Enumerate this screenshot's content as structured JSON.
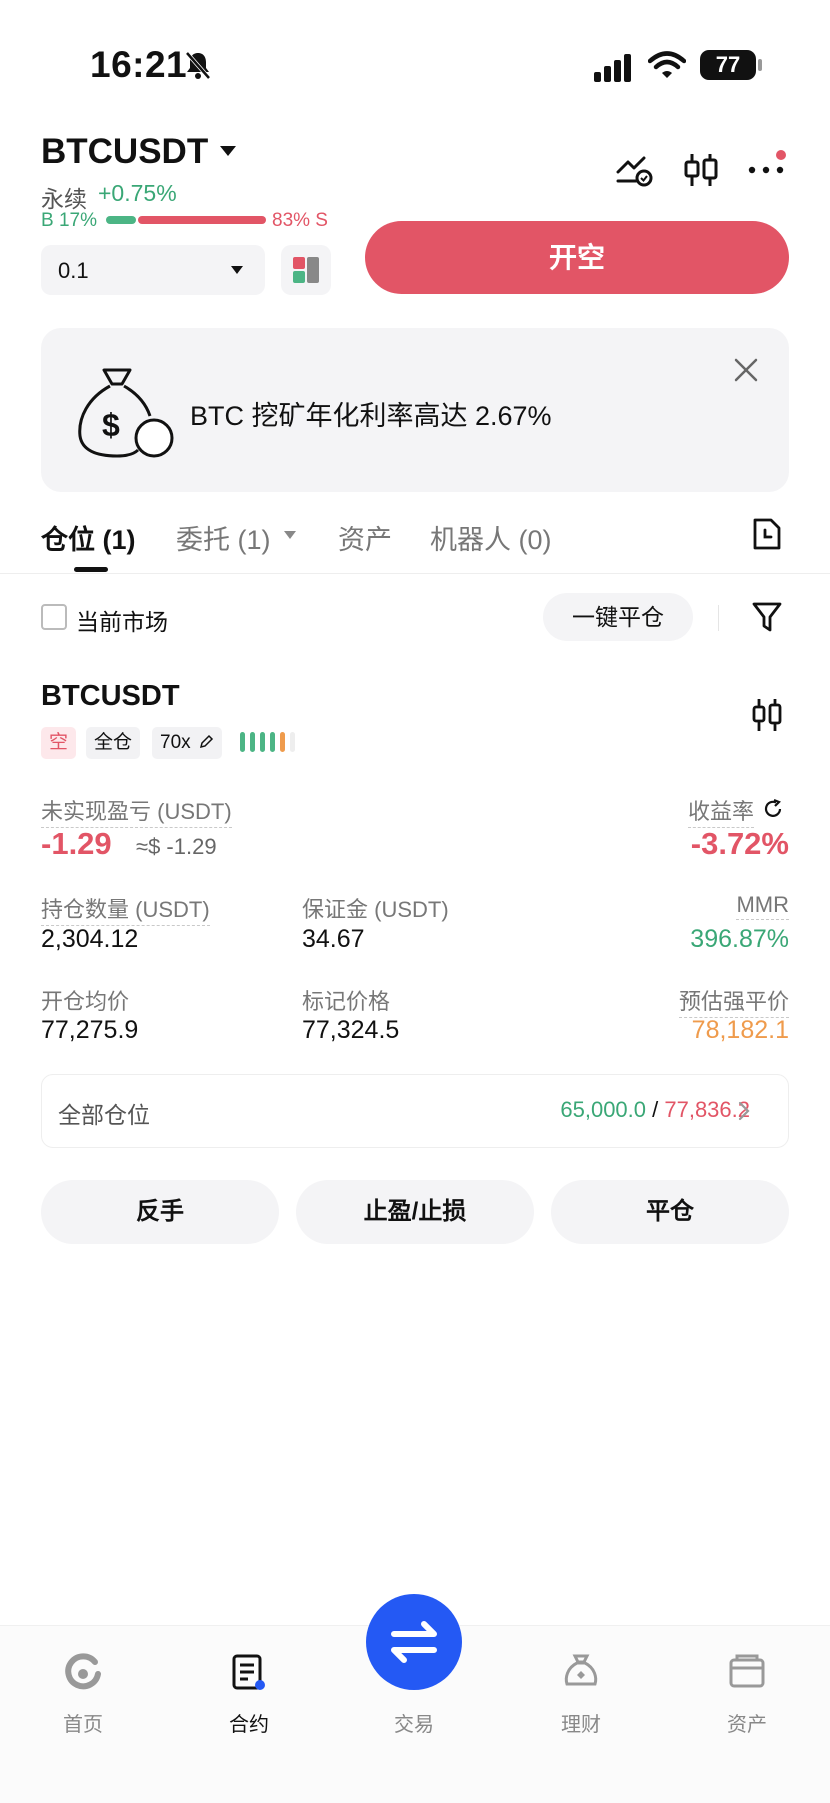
{
  "status_bar": {
    "time": "16:21",
    "battery": "77"
  },
  "header": {
    "pair": "BTCUSDT",
    "perp_label": "永续",
    "change": "+0.75%",
    "buy_ratio": "B 17%",
    "sell_ratio": "83% S",
    "buy_fraction": 0.17,
    "icons": [
      "price-alert-icon",
      "candlestick-icon",
      "more-icon"
    ]
  },
  "order": {
    "quantity": "0.1",
    "open_short_label": "开空"
  },
  "banner": {
    "text": "BTC 挖矿年化利率高达 2.67%"
  },
  "tabs": [
    {
      "label": "仓位 (1)",
      "active": true
    },
    {
      "label": "委托 (1)",
      "active": false
    },
    {
      "label": "资产",
      "active": false
    },
    {
      "label": "机器人 (0)",
      "active": false
    }
  ],
  "filters": {
    "current_market": "当前市场",
    "close_all": "一键平仓"
  },
  "position": {
    "symbol": "BTCUSDT",
    "side_tag": "空",
    "margin_mode": "全仓",
    "leverage": "70x",
    "unrealized_pnl_label": "未实现盈亏 (USDT)",
    "unrealized_pnl": "-1.29",
    "unrealized_pnl_usd": "≈$ -1.29",
    "roe_label": "收益率",
    "roe": "-3.72%",
    "size_label": "持仓数量 (USDT)",
    "size": "2,304.12",
    "margin_label": "保证金 (USDT)",
    "margin": "34.67",
    "mmr_label": "MMR",
    "mmr": "396.87%",
    "entry_label": "开仓均价",
    "entry_price": "77,275.9",
    "mark_label": "标记价格",
    "mark_price": "77,324.5",
    "liq_label": "预估强平价",
    "liq_price": "78,182.1",
    "all_positions_label": "全部仓位",
    "all_positions_long": "65,000.0",
    "all_positions_sep": " / ",
    "all_positions_short": "77,836.2",
    "actions": {
      "reverse": "反手",
      "tpsl": "止盈/止损",
      "close": "平仓"
    }
  },
  "nav": [
    {
      "label": "首页",
      "icon": "home-icon",
      "active": false
    },
    {
      "label": "合约",
      "icon": "futures-icon",
      "active": true
    },
    {
      "label": "交易",
      "icon": "swap-icon",
      "active": false
    },
    {
      "label": "理财",
      "icon": "earn-icon",
      "active": false
    },
    {
      "label": "资产",
      "icon": "wallet-icon",
      "active": false
    }
  ],
  "colors": {
    "red": "#e25566",
    "green": "#3aa776",
    "orange": "#ef9b4c",
    "blue": "#2459f4"
  }
}
